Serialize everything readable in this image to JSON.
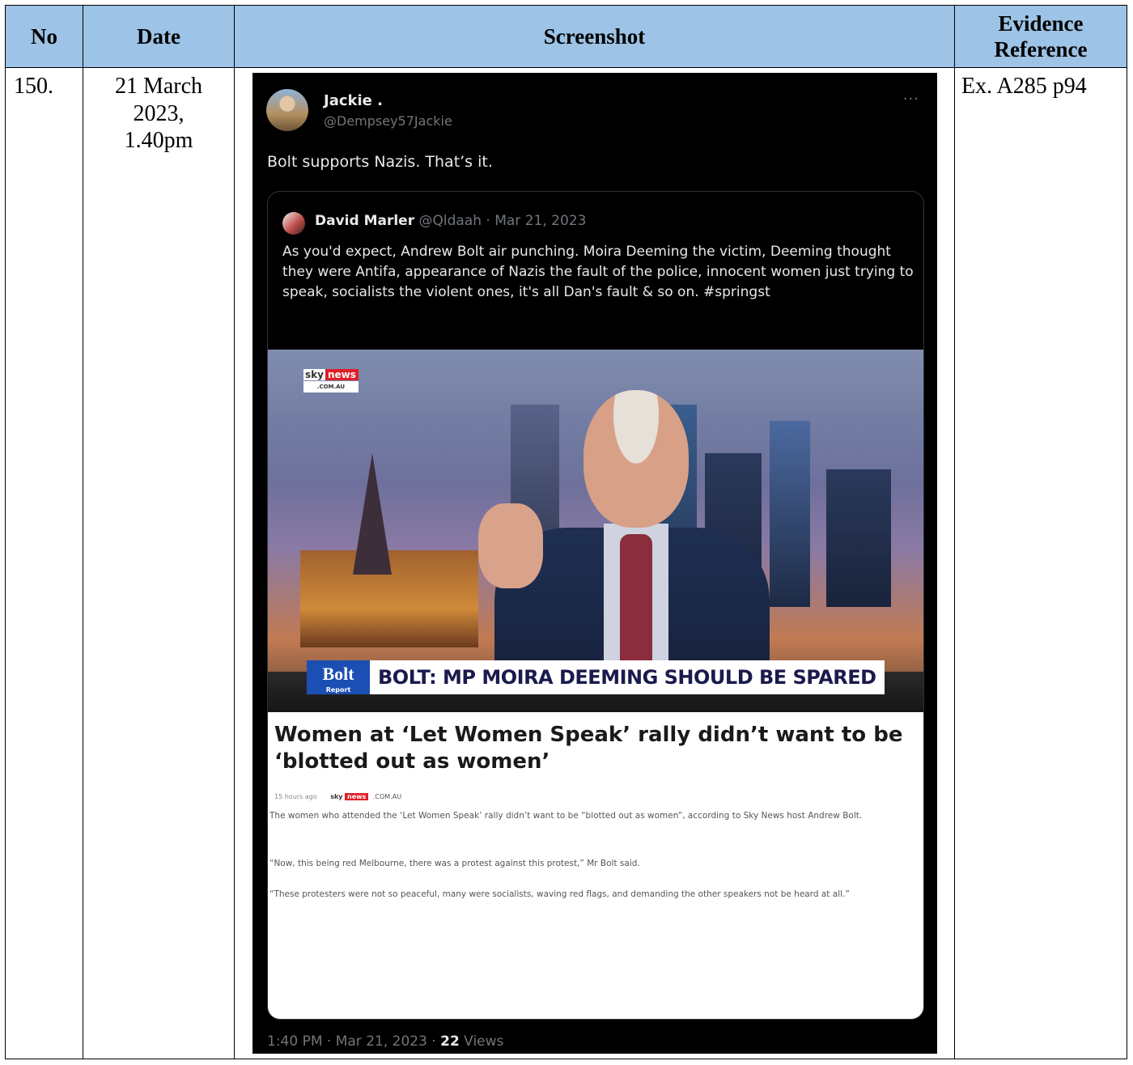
{
  "table": {
    "headers": {
      "no": "No",
      "date": "Date",
      "screenshot": "Screenshot",
      "evidence_line1": "Evidence",
      "evidence_line2": "Reference"
    },
    "row": {
      "no": "150.",
      "date_line1": "21 March",
      "date_line2": "2023,",
      "date_line3": "1.40pm",
      "evidence_ref": "Ex. A285 p94"
    }
  },
  "colors": {
    "header_bg": "#9dc3e6",
    "tweet_bg": "#000000",
    "muted_text": "#71767b",
    "sky_news_red": "#e01f26",
    "bolt_blue": "#1c4fb4"
  },
  "tweet": {
    "author_name": "Jackie .",
    "author_handle": "@Dempsey57Jackie",
    "more_icon": "more-horizontal-icon",
    "text": "Bolt supports Nazis. That’s it.",
    "quoted": {
      "author_name": "David Marler",
      "handle_date": "@Qldaah · Mar 21, 2023",
      "text": "As you'd expect, Andrew Bolt air punching. Moira Deeming the victim, Deeming thought they were Antifa, appearance of Nazis the fault of the police, innocent women just trying to speak, socialists the violent ones, it's all Dan's fault & so on. #springst",
      "media": {
        "sky_word": "sky",
        "news_word": "news",
        "comau_word": ".COM.AU",
        "bolt_word": "Bolt",
        "report_word": "Report",
        "headline": "BOLT: MP MOIRA DEEMING SHOULD BE SPARED"
      },
      "article": {
        "title": "Women at ‘Let Women Speak’ rally didn’t want to be ‘blotted out as women’",
        "time_ago": "15 hours ago",
        "sky_word": "sky",
        "news_word": "news",
        "comau_word": ".COM.AU",
        "paragraph1": "The women who attended the ‘Let Women Speak’ rally didn’t want to be “blotted out as women”, according to Sky News host Andrew Bolt.",
        "paragraph2": "“Now, this being red Melbourne, there was a protest against this protest,” Mr Bolt said.",
        "paragraph3": "“These protesters were not so peaceful, many were socialists, waving red flags, and demanding the other speakers not be heard at all.”"
      }
    },
    "timestamp": "1:40 PM · Mar 21, 2023 · ",
    "views_count": "22",
    "views_label": " Views",
    "actions": [
      "reply-icon",
      "retweet-icon",
      "like-icon",
      "bookmark-icon",
      "share-icon"
    ]
  }
}
